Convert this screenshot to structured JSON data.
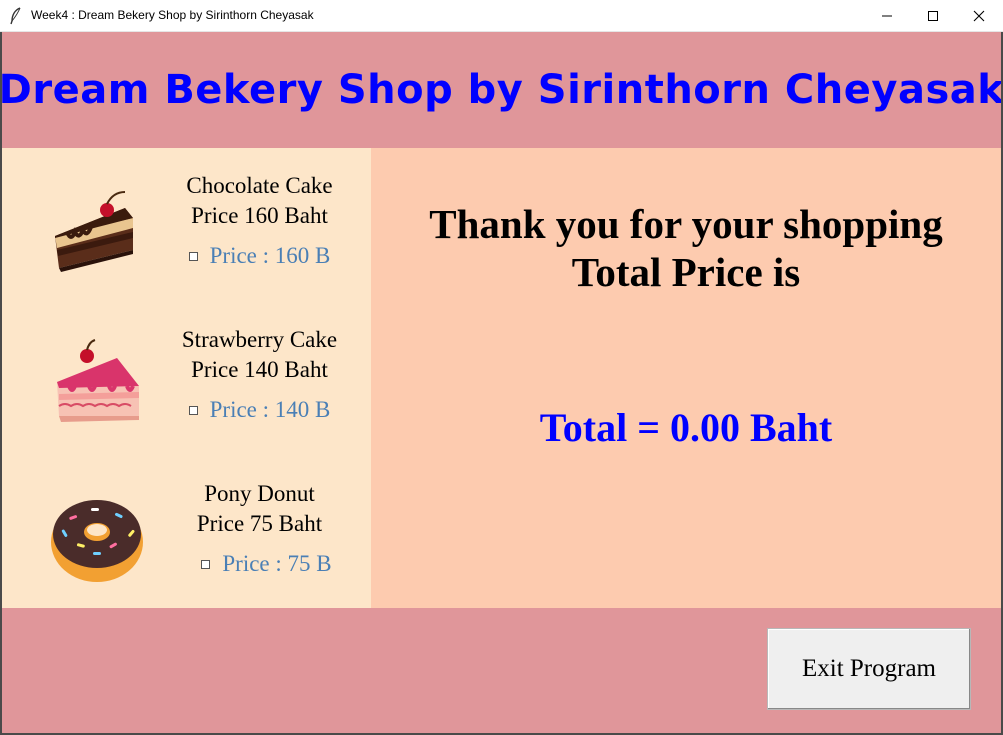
{
  "window": {
    "title": "Week4 : Dream Bekery Shop by Sirinthorn Cheyasak",
    "controls": [
      "minimize-icon",
      "maximize-icon",
      "close-icon"
    ]
  },
  "header": {
    "title": "Dream Bekery Shop by Sirinthorn Cheyasak"
  },
  "products": [
    {
      "name": "Chocolate Cake",
      "price_text": "Price 160 Baht",
      "option_label": "Price : 160 B",
      "checked": false,
      "icon": "chocolate-cake-icon"
    },
    {
      "name": "Strawberry Cake",
      "price_text": "Price 140 Baht",
      "option_label": "Price : 140 B",
      "checked": false,
      "icon": "strawberry-cake-icon"
    },
    {
      "name": "Pony Donut",
      "price_text": "Price 75 Baht",
      "option_label": "Price : 75 B",
      "checked": false,
      "icon": "donut-icon"
    }
  ],
  "summary": {
    "line1": "Thank you for your shopping",
    "line2": "Total Price is",
    "total": "Total = 0.00 Baht"
  },
  "footer": {
    "exit_label": "Exit Program"
  },
  "colors": {
    "header_bg": "#e0969a",
    "left_panel_bg": "#fde6c9",
    "right_panel_bg": "#fdcbaf",
    "title_color": "#0000ff",
    "option_color": "#4a7fb5"
  }
}
